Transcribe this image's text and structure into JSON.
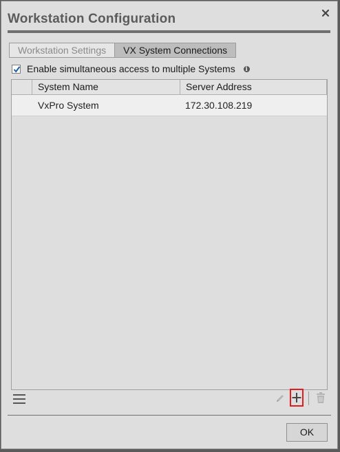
{
  "window": {
    "title": "Workstation Configuration"
  },
  "tabs": [
    {
      "label": "Workstation Settings",
      "active": false
    },
    {
      "label": "VX System Connections",
      "active": true
    }
  ],
  "options": {
    "simultaneous_access_label": "Enable simultaneous access to multiple Systems",
    "simultaneous_access_checked": true
  },
  "table": {
    "columns": [
      "System Name",
      "Server Address"
    ],
    "rows": [
      {
        "name": "VxPro System",
        "address": "172.30.108.219"
      }
    ]
  },
  "toolbar": {
    "icons": [
      "menu-icon",
      "pencil-icon",
      "plus-icon",
      "trash-icon"
    ],
    "highlight_color": "#e21c1c"
  },
  "footer": {
    "ok_label": "OK"
  }
}
